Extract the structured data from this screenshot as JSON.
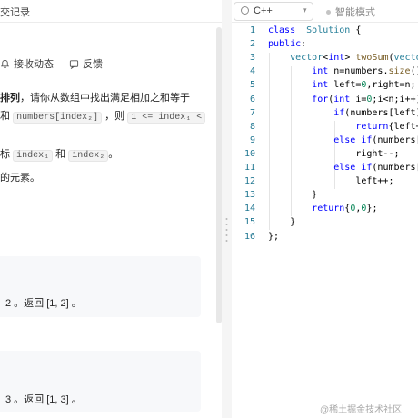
{
  "left": {
    "tab_partial": "交记录",
    "actions": [
      {
        "label": "接收动态",
        "icon": "bell-icon"
      },
      {
        "label": "反馈",
        "icon": "comment-icon"
      }
    ],
    "desc": {
      "l1a": "排列",
      "l1b": "，请你从数组中找出满足相加之和等于",
      "l2a": "和",
      "l2code1": "numbers[index₂]",
      "l2b": "，则",
      "l2code2": "1 <= index₁ <",
      "l3a": "标",
      "l3code1": "index₁",
      "l3b": "和",
      "l3code2": "index₂",
      "l3c": "。",
      "l4": "的元素。"
    },
    "examples": [
      {
        "text": "2 。返回 [1, 2] 。"
      },
      {
        "text": "3 。返回 [1, 3] 。"
      }
    ]
  },
  "editor": {
    "language": "C++",
    "smart_mode": "智能模式",
    "lines": [
      {
        "n": "1",
        "tokens": [
          [
            "kw",
            "class"
          ],
          [
            "",
            "  "
          ],
          [
            "ty",
            "Solution"
          ],
          [
            "",
            " {"
          ]
        ]
      },
      {
        "n": "2",
        "tokens": [
          [
            "kw",
            "public"
          ],
          [
            "",
            ":"
          ]
        ]
      },
      {
        "n": "3",
        "tokens": [
          [
            "",
            "    "
          ],
          [
            "ty",
            "vector"
          ],
          [
            "",
            "<"
          ],
          [
            "kw",
            "int"
          ],
          [
            "",
            "> "
          ],
          [
            "fn",
            "twoSum"
          ],
          [
            "",
            "("
          ],
          [
            "ty",
            "vecto"
          ]
        ]
      },
      {
        "n": "4",
        "tokens": [
          [
            "",
            "        "
          ],
          [
            "kw",
            "int"
          ],
          [
            "",
            " n=numbers."
          ],
          [
            "fn",
            "size"
          ],
          [
            "",
            "()"
          ]
        ]
      },
      {
        "n": "5",
        "tokens": [
          [
            "",
            "        "
          ],
          [
            "kw",
            "int"
          ],
          [
            "",
            " left="
          ],
          [
            "nm",
            "0"
          ],
          [
            "",
            ",right=n;"
          ]
        ]
      },
      {
        "n": "6",
        "tokens": [
          [
            "",
            "        "
          ],
          [
            "kw",
            "for"
          ],
          [
            "",
            "("
          ],
          [
            "kw",
            "int"
          ],
          [
            "",
            " i="
          ],
          [
            "nm",
            "0"
          ],
          [
            "",
            ";i<n;i++)"
          ]
        ]
      },
      {
        "n": "7",
        "tokens": [
          [
            "",
            "            "
          ],
          [
            "kw",
            "if"
          ],
          [
            "",
            "(numbers[left]"
          ]
        ]
      },
      {
        "n": "8",
        "tokens": [
          [
            "",
            "                "
          ],
          [
            "kw",
            "return"
          ],
          [
            "",
            "{left+"
          ]
        ]
      },
      {
        "n": "9",
        "tokens": [
          [
            "",
            "            "
          ],
          [
            "kw",
            "else if"
          ],
          [
            "",
            "(numbers["
          ]
        ]
      },
      {
        "n": "10",
        "tokens": [
          [
            "",
            "                right--;"
          ]
        ]
      },
      {
        "n": "11",
        "tokens": [
          [
            "",
            "            "
          ],
          [
            "kw",
            "else if"
          ],
          [
            "",
            "(numbers["
          ]
        ]
      },
      {
        "n": "12",
        "tokens": [
          [
            "",
            "                left++;"
          ]
        ]
      },
      {
        "n": "13",
        "tokens": [
          [
            "",
            "        }"
          ]
        ]
      },
      {
        "n": "14",
        "tokens": [
          [
            "",
            "        "
          ],
          [
            "kw",
            "return"
          ],
          [
            "",
            "{"
          ],
          [
            "nm",
            "0"
          ],
          [
            "",
            ","
          ],
          [
            "nm",
            "0"
          ],
          [
            "",
            "};"
          ]
        ]
      },
      {
        "n": "15",
        "tokens": [
          [
            "",
            "    }"
          ]
        ]
      },
      {
        "n": "16",
        "tokens": [
          [
            "",
            "};"
          ]
        ]
      }
    ]
  },
  "watermark": "@稀土掘金技术社区",
  "colors": {
    "keyword": "#0000ff",
    "type": "#267f99",
    "function": "#795e26",
    "number": "#098658",
    "line_number": "#237893"
  }
}
